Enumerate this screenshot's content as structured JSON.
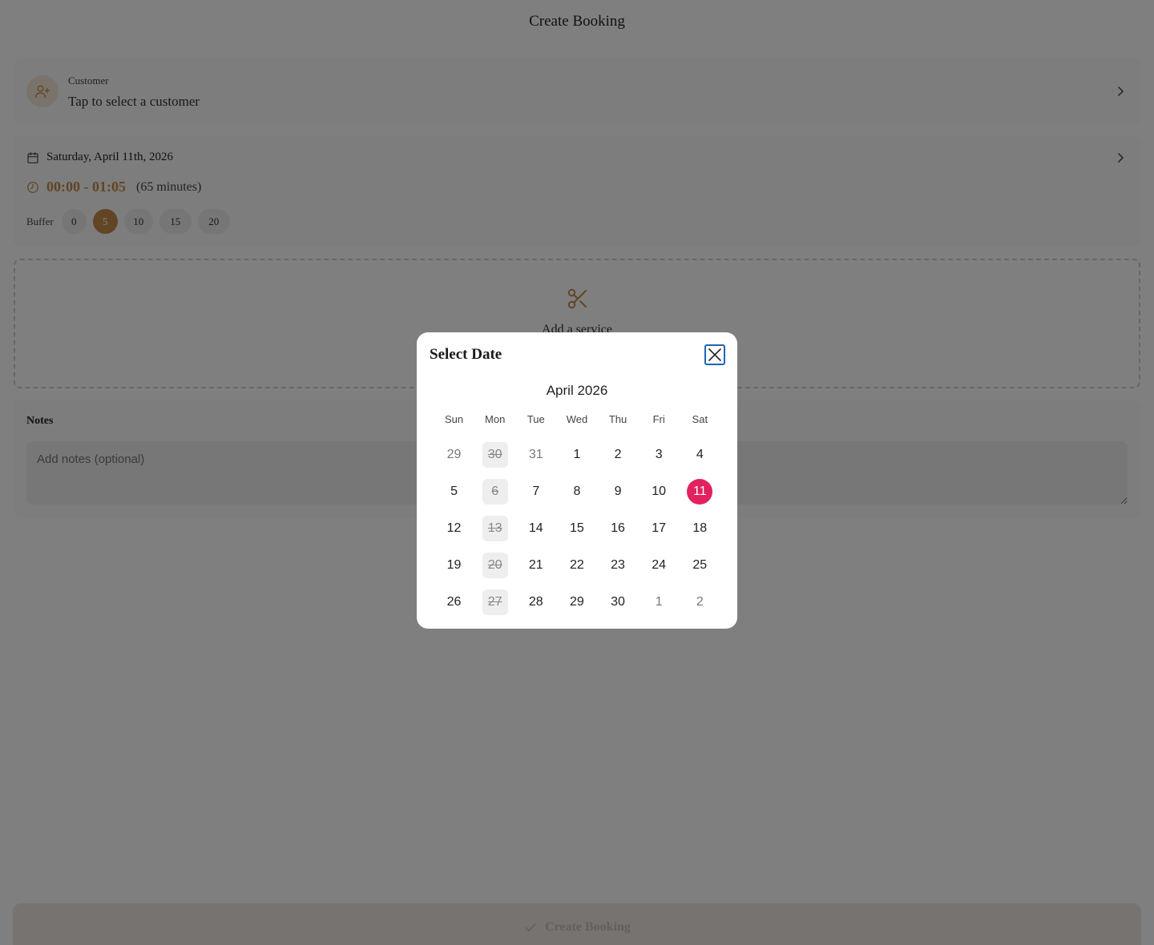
{
  "header": {
    "title": "Create Booking"
  },
  "customer": {
    "label": "Customer",
    "value": "Tap to select a customer"
  },
  "schedule": {
    "date": "Saturday, April 11th, 2026",
    "time_range": "00:00 - 01:05",
    "duration": "(65 minutes)",
    "buffer_label": "Buffer",
    "buffer_options": [
      "0",
      "5",
      "10",
      "15",
      "20"
    ],
    "buffer_selected": "5"
  },
  "service": {
    "label": "Add a service"
  },
  "notes": {
    "title": "Notes",
    "placeholder": "Add notes (optional)"
  },
  "footer": {
    "create_label": "Create Booking"
  },
  "modal": {
    "title": "Select Date",
    "month": "April 2026",
    "weekdays": [
      "Sun",
      "Mon",
      "Tue",
      "Wed",
      "Thu",
      "Fri",
      "Sat"
    ],
    "weeks": [
      [
        "29",
        "30",
        "31",
        "1",
        "2",
        "3",
        "4"
      ],
      [
        "5",
        "6",
        "7",
        "8",
        "9",
        "10",
        "11"
      ],
      [
        "12",
        "13",
        "14",
        "15",
        "16",
        "17",
        "18"
      ],
      [
        "19",
        "20",
        "21",
        "22",
        "23",
        "24",
        "25"
      ],
      [
        "26",
        "27",
        "28",
        "29",
        "30",
        "1",
        "2"
      ]
    ],
    "selected_day": "11",
    "disabled_days": [
      "30",
      "6",
      "13",
      "20",
      "27"
    ]
  },
  "colors": {
    "accent": "#c58a4b",
    "selected_day": "#e2215f",
    "close_focus": "#1d64b7"
  },
  "icons": {
    "customer": "user-plus-icon",
    "date": "calendar-icon",
    "time": "clock-icon",
    "service": "scissors-icon",
    "close": "close-icon",
    "chevron": "chevron-right-icon",
    "create": "check-icon"
  }
}
